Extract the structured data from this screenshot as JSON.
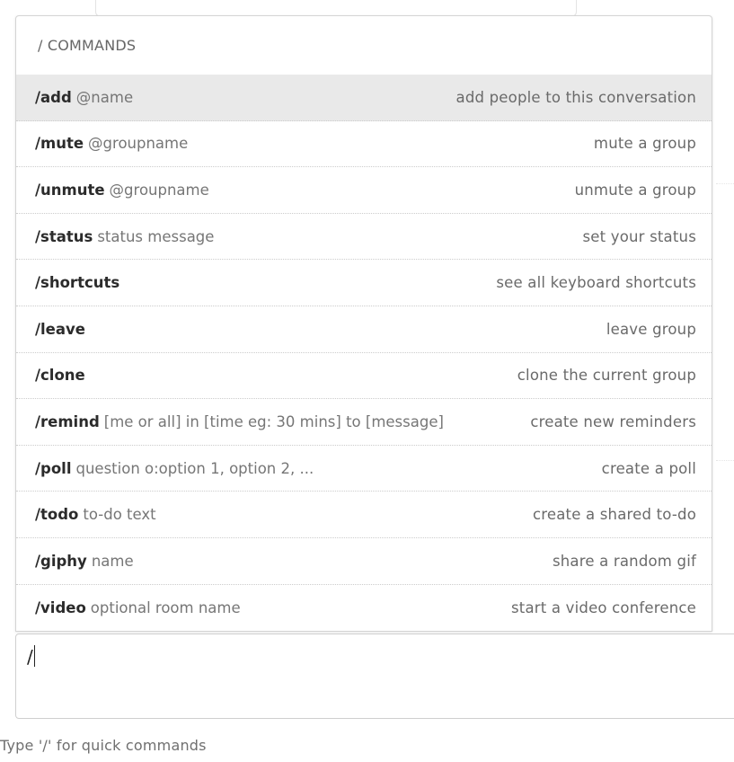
{
  "popup": {
    "header": "/ COMMANDS",
    "commands": [
      {
        "name": "/add",
        "args": "@name",
        "description": "add people to this conversation",
        "active": true
      },
      {
        "name": "/mute",
        "args": "@groupname",
        "description": "mute a group"
      },
      {
        "name": "/unmute",
        "args": "@groupname",
        "description": "unmute a group"
      },
      {
        "name": "/status",
        "args": "status message",
        "description": "set your status"
      },
      {
        "name": "/shortcuts",
        "args": "",
        "description": "see all keyboard shortcuts"
      },
      {
        "name": "/leave",
        "args": "",
        "description": "leave group"
      },
      {
        "name": "/clone",
        "args": "",
        "description": "clone the current group"
      },
      {
        "name": "/remind",
        "args": "[me or all] in [time eg: 30 mins] to [message]",
        "description": "create new reminders"
      },
      {
        "name": "/poll",
        "args": "question o:option 1, option 2, ...",
        "description": "create a poll"
      },
      {
        "name": "/todo",
        "args": "to-do text",
        "description": "create a shared to-do"
      },
      {
        "name": "/giphy",
        "args": "name",
        "description": "share a random gif"
      },
      {
        "name": "/video",
        "args": "optional room name",
        "description": "start a video conference"
      }
    ]
  },
  "composer": {
    "value": "/"
  },
  "hint": "Type '/' for quick commands",
  "colors": {
    "active_row_bg": "#e9e9e9",
    "border": "#d4d4d4",
    "muted_text": "#767676"
  }
}
